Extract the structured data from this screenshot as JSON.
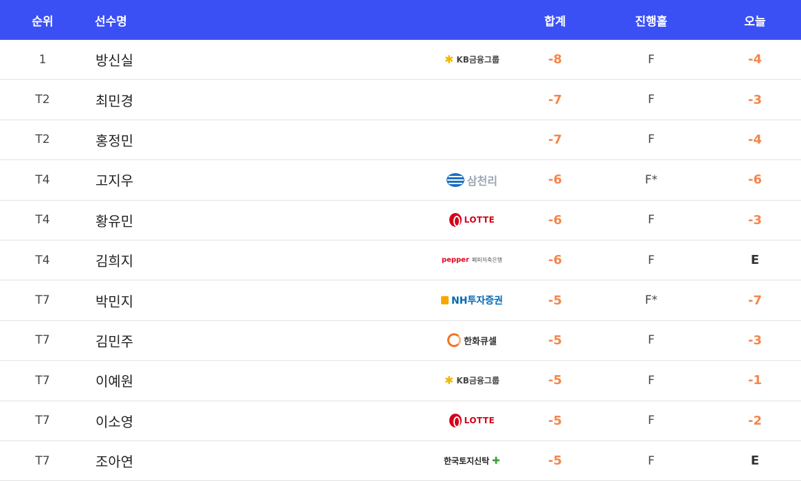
{
  "header": {
    "rank": "순위",
    "name": "선수명",
    "total": "합계",
    "hole": "진행홀",
    "today": "오늘"
  },
  "sponsors": {
    "kb": "KB금융그룹",
    "samchully": "삼천리",
    "lotte": "LOTTE",
    "pepper": "pepper",
    "pepper_sub": "페퍼저축은행",
    "nh": "NH투자증권",
    "hanwha": "한화큐셀",
    "koreit": "한국토지신탁"
  },
  "rows": [
    {
      "rank": "1",
      "name": "방신실",
      "sponsor": "kb",
      "total": "-8",
      "hole": "F",
      "today": "-4"
    },
    {
      "rank": "T2",
      "name": "최민경",
      "sponsor": "",
      "total": "-7",
      "hole": "F",
      "today": "-3"
    },
    {
      "rank": "T2",
      "name": "홍정민",
      "sponsor": "",
      "total": "-7",
      "hole": "F",
      "today": "-4"
    },
    {
      "rank": "T4",
      "name": "고지우",
      "sponsor": "samchully",
      "total": "-6",
      "hole": "F*",
      "today": "-6"
    },
    {
      "rank": "T4",
      "name": "황유민",
      "sponsor": "lotte",
      "total": "-6",
      "hole": "F",
      "today": "-3"
    },
    {
      "rank": "T4",
      "name": "김희지",
      "sponsor": "pepper",
      "total": "-6",
      "hole": "F",
      "today": "E"
    },
    {
      "rank": "T7",
      "name": "박민지",
      "sponsor": "nh",
      "total": "-5",
      "hole": "F*",
      "today": "-7"
    },
    {
      "rank": "T7",
      "name": "김민주",
      "sponsor": "hanwha",
      "total": "-5",
      "hole": "F",
      "today": "-3"
    },
    {
      "rank": "T7",
      "name": "이예원",
      "sponsor": "kb",
      "total": "-5",
      "hole": "F",
      "today": "-1"
    },
    {
      "rank": "T7",
      "name": "이소영",
      "sponsor": "lotte",
      "total": "-5",
      "hole": "F",
      "today": "-2"
    },
    {
      "rank": "T7",
      "name": "조아연",
      "sponsor": "koreit",
      "total": "-5",
      "hole": "F",
      "today": "E"
    }
  ],
  "colors": {
    "header_bg": "#3a50f5",
    "under_par": "#f5854a",
    "even_par": "#333333"
  }
}
